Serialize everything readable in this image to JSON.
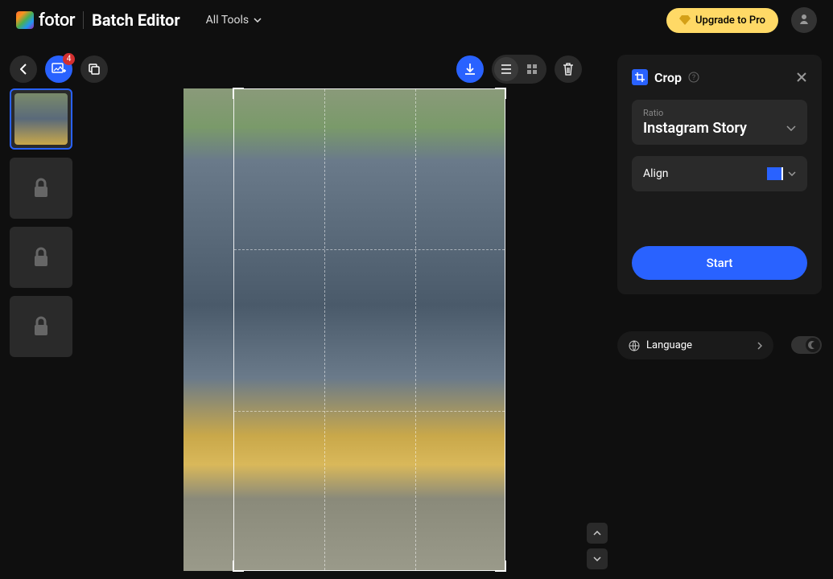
{
  "header": {
    "logo_text": "fotor",
    "app_title": "Batch Editor",
    "all_tools": "All Tools",
    "upgrade": "Upgrade to Pro"
  },
  "toolbar": {
    "image_count": "4"
  },
  "crop_panel": {
    "title": "Crop",
    "ratio_label": "Ratio",
    "ratio_value": "Instagram Story",
    "align_label": "Align",
    "start": "Start"
  },
  "language": {
    "label": "Language"
  },
  "colors": {
    "primary": "#2962ff",
    "upgrade_bg": "#ffd966"
  }
}
